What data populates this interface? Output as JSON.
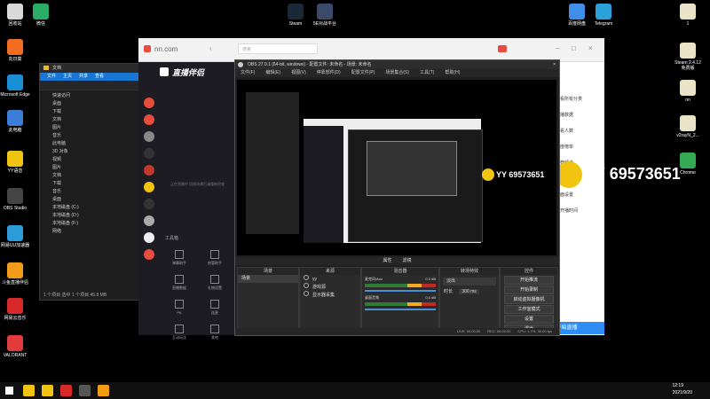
{
  "desktop_left": [
    {
      "label": "回收站",
      "color": "#d9d9d9"
    },
    {
      "label": "微信",
      "color": "#2aae67"
    },
    {
      "label": "向日葵",
      "color": "#f26d21"
    },
    {
      "label": "Microsoft Edge",
      "color": "#1a8fd6"
    },
    {
      "label": "此电脑",
      "color": "#3b7dd8"
    },
    {
      "label": "YY语音",
      "color": "#f1c40f"
    },
    {
      "label": "OBS Studio",
      "color": "#444"
    },
    {
      "label": "网易UU加速器",
      "color": "#2c9cd8"
    },
    {
      "label": "斗鱼直播伴侣",
      "color": "#f29b1b"
    },
    {
      "label": "网易云音乐",
      "color": "#d8282a"
    },
    {
      "label": "VALORANT",
      "color": "#e23b3b"
    }
  ],
  "desktop_top": [
    {
      "label": "Steam",
      "color": "#1b2838"
    },
    {
      "label": "5E对战平台",
      "color": "#3b4a6b"
    }
  ],
  "desktop_right": [
    {
      "label": "百度网盘",
      "color": "#3f8ee8"
    },
    {
      "label": "Telegram",
      "color": "#2aa1da"
    },
    {
      "label": "1",
      "color": "#e9e4c7"
    },
    {
      "label": "Steam 2.4.12免费版",
      "color": "#e9e4c7"
    },
    {
      "label": "nn",
      "color": "#e9e4c7"
    },
    {
      "label": "v2rayN_2...",
      "color": "#e9e4c7"
    },
    {
      "label": "Chrome",
      "color": "#34a853"
    }
  ],
  "explorer": {
    "title": "文档",
    "ribbon": [
      "文件",
      "主页",
      "共享",
      "查看"
    ],
    "tree": [
      "快速访问",
      "桌面",
      "下载",
      "文档",
      "图片",
      "音乐",
      "此电脑",
      "3D 对象",
      "视频",
      "图片",
      "文档",
      "下载",
      "音乐",
      "桌面",
      "本地磁盘 (C:)",
      "本地磁盘 (D:)",
      "本地磁盘 (F:)",
      "网络"
    ],
    "status": "1 个项目   选中 1 个项目 45.8 MB"
  },
  "browser": {
    "url": "nn.com",
    "search_placeholder": "搜索",
    "app_title": "直播伴侣",
    "toolbar_label": "工具箱",
    "tools": [
      "弹幕助手",
      "房管助手",
      "直播数据",
      "礼物设置",
      "PK",
      "连麦",
      "互动玩法",
      "其他"
    ],
    "notice": "正在直播中,切换场景后请重新检查",
    "right_text": [
      "查看所有分类",
      "直播数据",
      "观看人数",
      "热度榜单",
      "推荐频道",
      "弹幕管理",
      "封面设置",
      "已开播时间"
    ],
    "start_button": "开始直播"
  },
  "obs": {
    "title": "OBS 27.0.1 (64-bit, windows) - 配置文件: 未命名 - 场景: 未命名",
    "menu": [
      "文件(F)",
      "编辑(E)",
      "视图(V)",
      "停靠部件(D)",
      "配置文件(P)",
      "场景集合(S)",
      "工具(T)",
      "帮助(H)"
    ],
    "preview_bar": [
      "属性",
      "滤镜"
    ],
    "panels": {
      "scenes": {
        "header": "场景",
        "items": [
          "场景"
        ]
      },
      "sources": {
        "header": "来源",
        "items": [
          "yy",
          "游戏源",
          "显示器采集"
        ]
      },
      "mixer": {
        "header": "混音器",
        "channels": [
          {
            "name": "麦克风/Aux",
            "db": "0.0 dB"
          },
          {
            "name": "桌面音频",
            "db": "0.0 dB"
          }
        ]
      },
      "transitions": {
        "header": "转场特效",
        "type": "淡出",
        "duration_label": "时长",
        "duration": "300 ms"
      },
      "controls": {
        "header": "控件",
        "buttons": [
          "开始推流",
          "开始录制",
          "启动虚拟摄像机",
          "工作室模式",
          "设置",
          "退出"
        ]
      }
    },
    "status": [
      "LIVE: 00:00:00",
      "REC: 00:00:00",
      "CPU: 1.7%, 30.00 fps"
    ]
  },
  "yy_overlay": {
    "text": "YY 69573651"
  },
  "yy_overlay_small": {
    "text": "YY 69573651"
  },
  "taskbar": {
    "time": "12:19",
    "date": "2021/9/20",
    "apps": [
      {
        "name": "explorer-icon",
        "color": "#f1c40f"
      },
      {
        "name": "yy-icon",
        "color": "#f1c40f"
      },
      {
        "name": "douyu-icon",
        "color": "#d8282a"
      },
      {
        "name": "obs-icon",
        "color": "#555"
      },
      {
        "name": "live-companion-icon",
        "color": "#f39c12"
      }
    ]
  }
}
